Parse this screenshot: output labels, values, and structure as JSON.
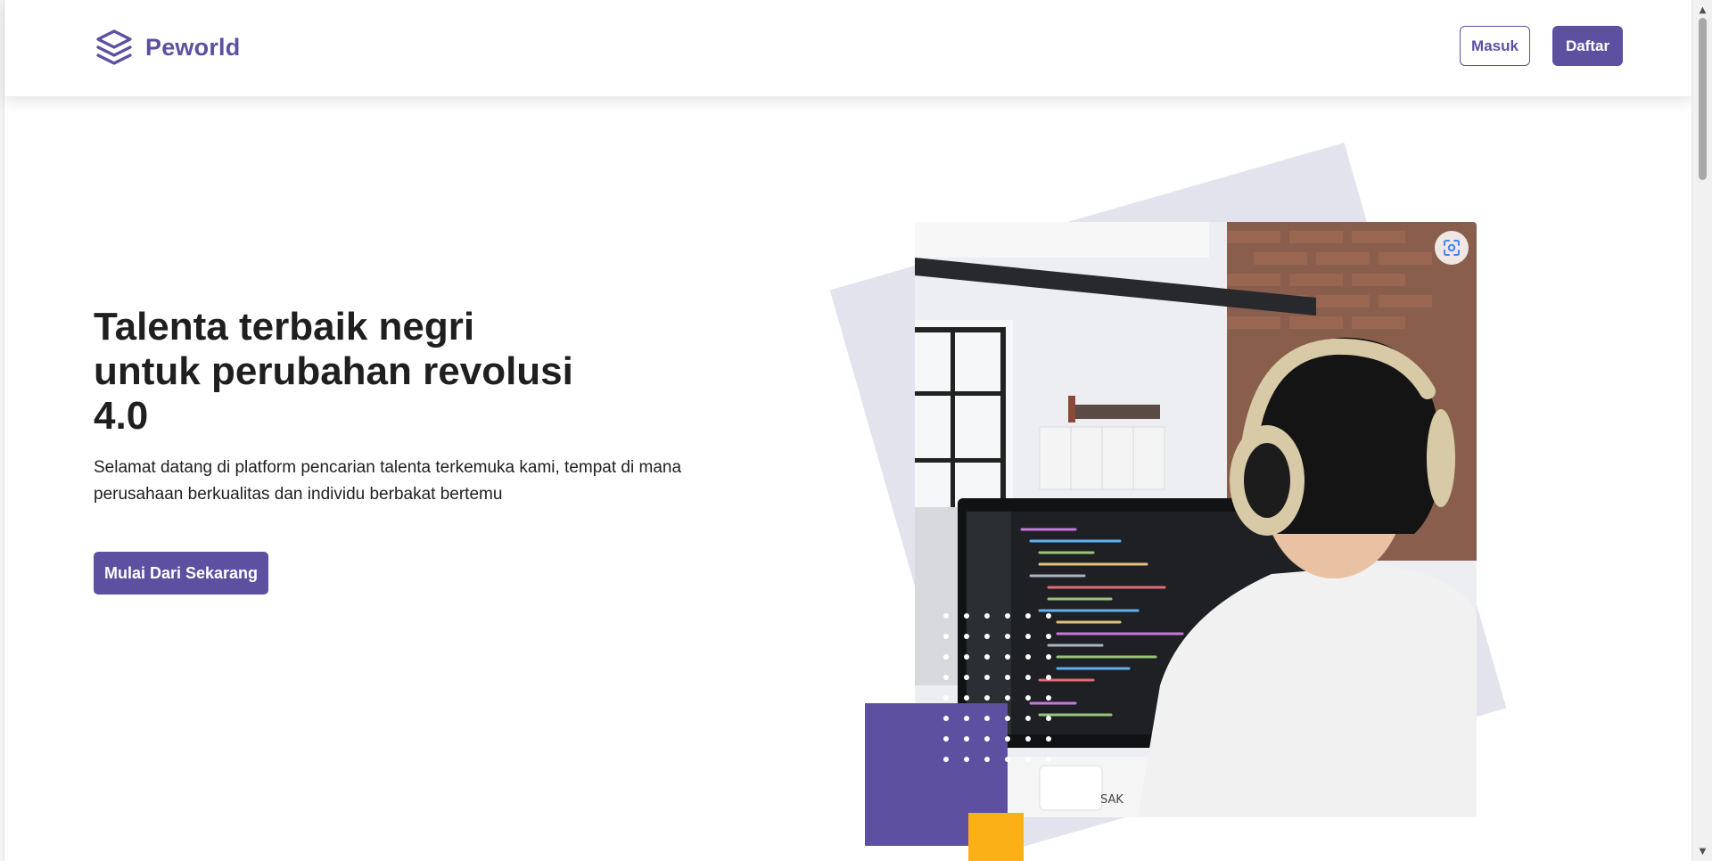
{
  "header": {
    "brand_name": "Peworld",
    "login_label": "Masuk",
    "register_label": "Daftar"
  },
  "hero": {
    "title_lines": [
      "Talenta terbaik negri",
      "untuk perubahan revolusi",
      "4.0"
    ],
    "description": "Selamat datang di platform pencarian talenta terkemuka kami, tempat di mana perusahaan berkualitas dan individu berbakat bertemu",
    "cta_label": "Mulai Dari Sekarang"
  },
  "image": {
    "alt": "Programmer with headphones coding at a computer",
    "photo_text": "SAK"
  },
  "icons": {
    "logo": "stacked-layers-icon",
    "lens": "google-lens-icon"
  },
  "colors": {
    "primary": "#5e50a1",
    "accent": "#fbb017",
    "shape_bg": "#e3e3ee",
    "text": "#1f1f1f"
  }
}
